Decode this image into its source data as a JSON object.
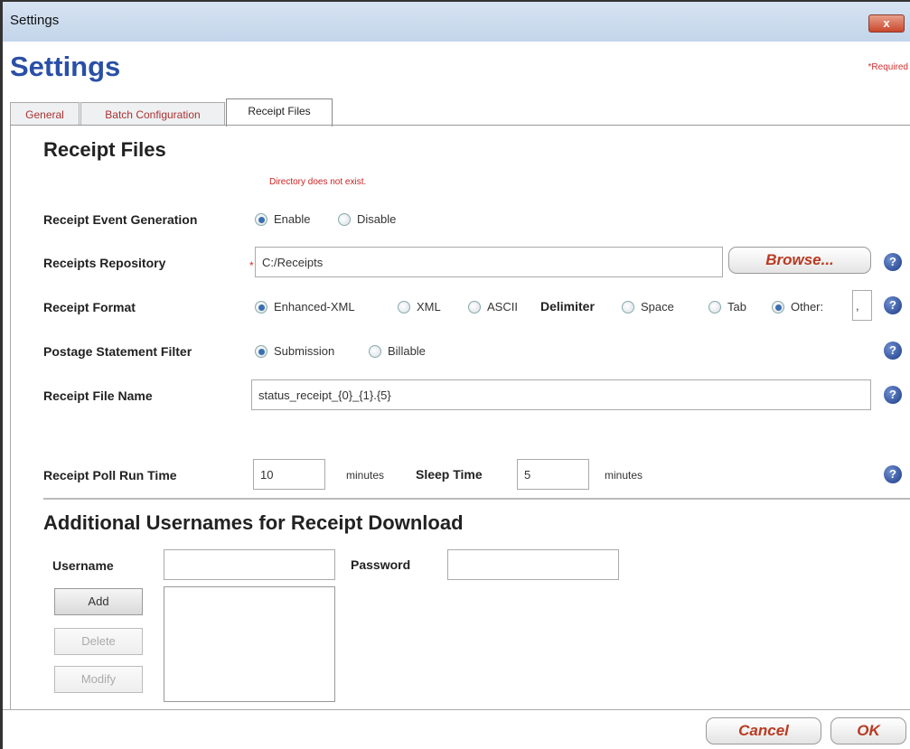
{
  "window": {
    "title": "Settings",
    "close_label": "x"
  },
  "header": {
    "title": "Settings",
    "required_note": "*Required"
  },
  "tabs": [
    {
      "label": "General"
    },
    {
      "label": "Batch Configuration"
    },
    {
      "label": "Receipt Files"
    }
  ],
  "receipt_files": {
    "heading": "Receipt Files",
    "error_message": "Directory does not exist.",
    "event_generation": {
      "label": "Receipt Event Generation",
      "options": [
        "Enable",
        "Disable"
      ],
      "selected": "Enable"
    },
    "repository": {
      "label": "Receipts Repository",
      "required_mark": "*",
      "value": "C:/Receipts",
      "browse_label": "Browse..."
    },
    "format": {
      "label": "Receipt Format",
      "options": [
        "Enhanced-XML",
        "XML",
        "ASCII"
      ],
      "selected": "Enhanced-XML",
      "delimiter_label": "Delimiter",
      "delimiter_options": [
        "Space",
        "Tab",
        "Other:"
      ],
      "delimiter_selected": "Other:",
      "other_value": ","
    },
    "postage_filter": {
      "label": "Postage Statement Filter",
      "options": [
        "Submission",
        "Billable"
      ],
      "selected": "Submission"
    },
    "file_name": {
      "label": "Receipt File Name",
      "value": "status_receipt_{0}_{1}.{5}"
    },
    "poll": {
      "label": "Receipt Poll Run Time",
      "run_value": "10",
      "run_unit": "minutes",
      "sleep_label": "Sleep Time",
      "sleep_value": "5",
      "sleep_unit": "minutes"
    },
    "help_glyph": "?"
  },
  "additional_users": {
    "heading": "Additional Usernames for Receipt Download",
    "username_label": "Username",
    "username_value": "",
    "password_label": "Password",
    "password_value": "",
    "add_label": "Add",
    "delete_label": "Delete",
    "modify_label": "Modify"
  },
  "footer": {
    "cancel_label": "Cancel",
    "ok_label": "OK"
  },
  "colors": {
    "title_blue": "#2a4fa6",
    "accent_red": "#b93a21",
    "error_red": "#cc2222",
    "radio_blue": "#3a6fb0"
  }
}
